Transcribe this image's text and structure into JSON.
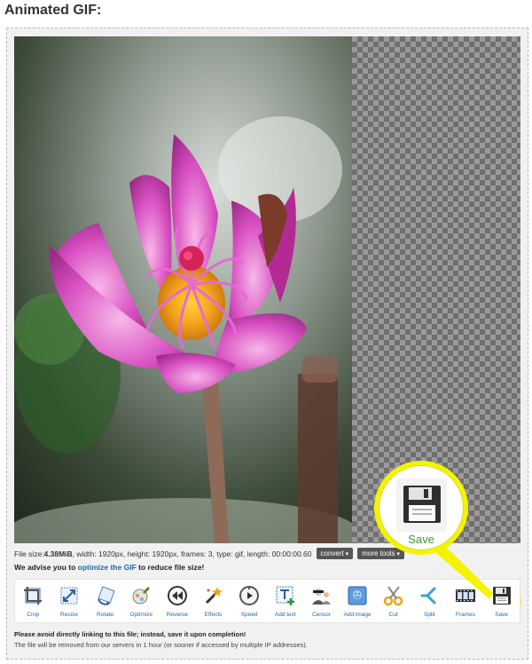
{
  "heading": "Animated GIF:",
  "file_info": {
    "prefix": "File size: ",
    "size": "4.38MiB",
    "details": ", width: 1920px, height: 1920px, frames: 3, type: gif, length: 00:00:00.6",
    "suffix": "0",
    "convert_label": "convert",
    "more_tools_label": "more tools"
  },
  "advise": {
    "before": "We advise you to ",
    "link": "optimize the GIF",
    "after": " to reduce file size!"
  },
  "tools": [
    {
      "label": "Crop",
      "icon": "crop-icon"
    },
    {
      "label": "Resize",
      "icon": "resize-icon"
    },
    {
      "label": "Rotate",
      "icon": "rotate-icon"
    },
    {
      "label": "Optimize",
      "icon": "optimize-icon"
    },
    {
      "label": "Reverse",
      "icon": "reverse-icon"
    },
    {
      "label": "Effects",
      "icon": "effects-icon"
    },
    {
      "label": "Speed",
      "icon": "speed-icon"
    },
    {
      "label": "Add text",
      "icon": "add-text-icon"
    },
    {
      "label": "Censor",
      "icon": "censor-icon"
    },
    {
      "label": "Add image",
      "icon": "add-image-icon"
    },
    {
      "label": "Cut",
      "icon": "cut-icon"
    },
    {
      "label": "Split",
      "icon": "split-icon"
    },
    {
      "label": "Frames",
      "icon": "frames-icon"
    },
    {
      "label": "Save",
      "icon": "save-icon"
    }
  ],
  "notice": {
    "line1": "Please avoid directly linking to this file; instead, save it upon completion!",
    "line2": "The file will be removed from our servers in 1 hour (or sooner if accessed by multiple IP addresses)."
  },
  "callout": {
    "label": "Save",
    "accent": "#f4f400",
    "label_color": "#3a9a2e"
  },
  "colors": {
    "link": "#1b67b3",
    "dropdown_bg": "#555555"
  }
}
